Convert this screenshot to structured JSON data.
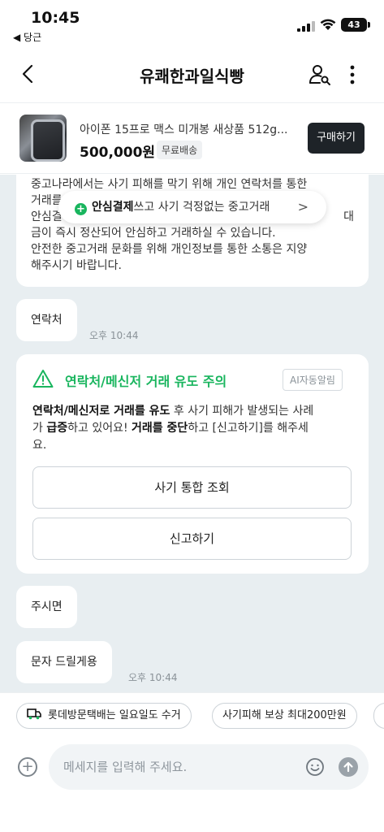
{
  "status_bar": {
    "time": "10:45",
    "back_app": "◀ 당근",
    "battery": "43"
  },
  "nav": {
    "title": "유쾌한과일식빵"
  },
  "product": {
    "name": "아이폰 15프로 맥스 미개봉 새상품 512g...",
    "price": "500,000원",
    "shipping": "무료배송",
    "buy_label": "구매하기"
  },
  "notice": {
    "line1": "중고나라에서는 사기 피해를 막기 위해 개인 연락처를 통한",
    "line2": "거래를",
    "line3_start": "안심결",
    "line3_end": "대",
    "line4": "금이 즉시 정산되어 안심하고 거래하실 수 있습니다.",
    "line5": "안전한 중고거래 문화를 위해 개인정보를 통한 소통은 지양",
    "line6": "해주시기 바랍니다."
  },
  "safe_pay": {
    "bold": "안심결제",
    "rest": "쓰고 사기 걱정없는 중고거래",
    "chevron": ">"
  },
  "messages": [
    {
      "text": "연락처",
      "time": "오후 10:44"
    },
    {
      "text": "주시면"
    },
    {
      "text": "문자 드릴게용",
      "time": "오후 10:44"
    }
  ],
  "warning": {
    "title": "연락처/메신저 거래 유도 주의",
    "tag": "AI자동알림",
    "b1": "연락처/메신저로 거래를 유도",
    "t1": " 후 사기 피해가 발생되는 사례",
    "t2": "가 ",
    "b2": "급증",
    "t3": "하고 있어요! ",
    "b3": "거래를 중단",
    "t4": "하고 [신고하기]를 해주세",
    "t5": "요.",
    "button1": "사기 통합 조회",
    "button2": "신고하기"
  },
  "chips": [
    {
      "label": "롯데방문택배는 일요일도 수거",
      "icon": "truck-icon"
    },
    {
      "label": "사기피해 보상 최대200만원"
    }
  ],
  "input": {
    "placeholder": "메세지를 입력해 주세요."
  },
  "colors": {
    "accent_green": "#19b55e",
    "chat_bg": "#e8eef1",
    "buy_button": "#1e2328"
  }
}
